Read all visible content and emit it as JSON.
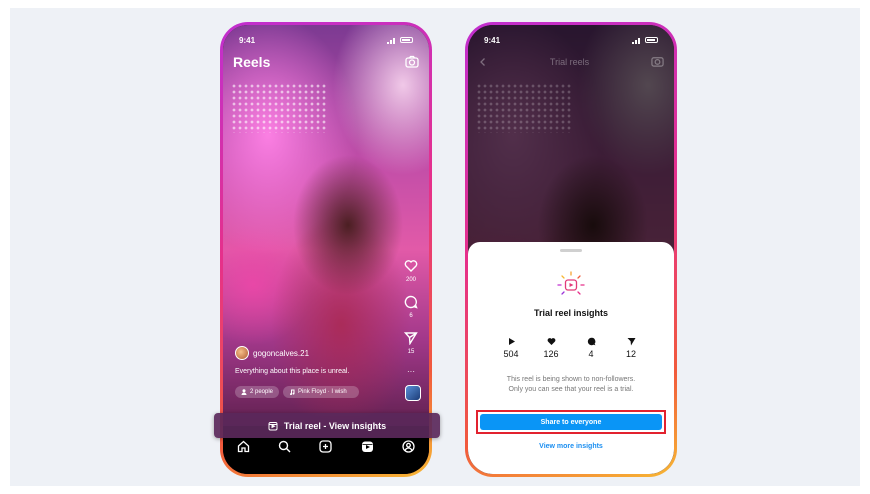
{
  "phone_left": {
    "status_time": "9:41",
    "title": "Reels",
    "rail": {
      "likes": "200",
      "comments": "6",
      "shares": "15"
    },
    "username": "gogoncalves.21",
    "caption": "Everything about this place is unreal.",
    "more_glyph": "···",
    "chips": {
      "people": "2 people",
      "music": "Pink Floyd · I wish"
    },
    "trial_banner": "Trial reel - View insights"
  },
  "phone_right": {
    "status_time": "9:41",
    "header_title": "Trial reels",
    "sheet": {
      "title": "Trial reel insights",
      "stats": {
        "plays": "504",
        "likes": "126",
        "comments": "4",
        "shares": "12"
      },
      "description_line1": "This reel is being shown to non-followers.",
      "description_line2": "Only you can see that your reel is a trial.",
      "share_button": "Share to everyone",
      "more_link": "View more insights"
    }
  },
  "colors": {
    "accent_blue": "#0a95f6",
    "highlight_red": "#e2222f",
    "link_blue": "#1a8ef0"
  },
  "icons": [
    "camera-icon",
    "heart-icon",
    "comment-icon",
    "send-icon",
    "home-icon",
    "search-icon",
    "create-icon",
    "reels-icon",
    "profile-icon",
    "play-icon",
    "back-icon"
  ]
}
